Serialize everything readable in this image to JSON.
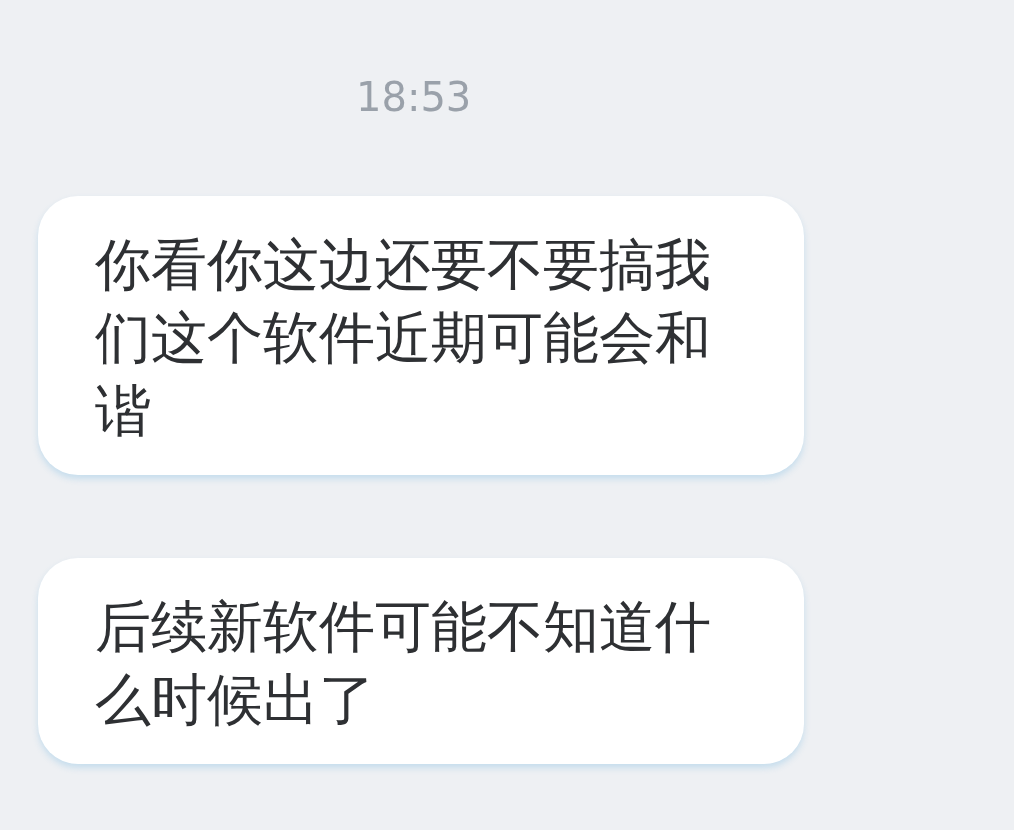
{
  "timestamp": "18:53",
  "messages": [
    {
      "text": "你看你这边还要不要搞我们这个软件近期可能会和谐"
    },
    {
      "text": "后续新软件可能不知道什么时候出了"
    }
  ]
}
